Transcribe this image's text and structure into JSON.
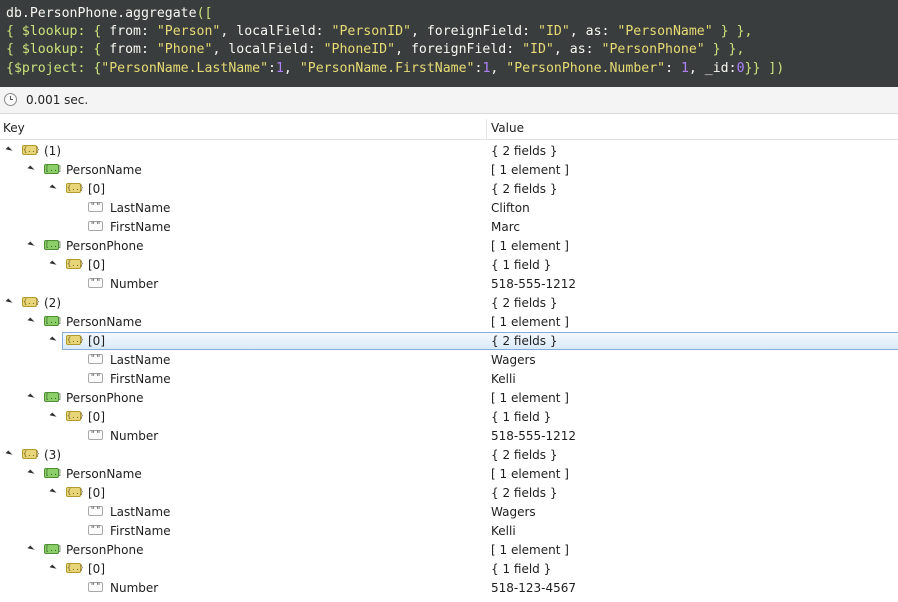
{
  "editor": {
    "lines": [
      [
        [
          "pk",
          "db.PersonPhone.aggregate"
        ],
        [
          "kw",
          "(["
        ]
      ],
      [
        [
          "kw",
          "{ $lookup: { "
        ],
        [
          "pk",
          "from: "
        ],
        [
          "str",
          "\"Person\""
        ],
        [
          "pk",
          ", localField: "
        ],
        [
          "str",
          "\"PersonID\""
        ],
        [
          "pk",
          ", foreignField: "
        ],
        [
          "str",
          "\"ID\""
        ],
        [
          "pk",
          ", as: "
        ],
        [
          "str",
          "\"PersonName\""
        ],
        [
          "kw",
          " } },"
        ]
      ],
      [
        [
          "kw",
          "{ $lookup: { "
        ],
        [
          "pk",
          "from: "
        ],
        [
          "str",
          "\"Phone\""
        ],
        [
          "pk",
          ", localField: "
        ],
        [
          "str",
          "\"PhoneID\""
        ],
        [
          "pk",
          ", foreignField: "
        ],
        [
          "str",
          "\"ID\""
        ],
        [
          "pk",
          ", as: "
        ],
        [
          "str",
          "\"PersonPhone\""
        ],
        [
          "kw",
          " } },"
        ]
      ],
      [
        [
          "kw",
          "{$project: {"
        ],
        [
          "str",
          "\"PersonName.LastName\""
        ],
        [
          "pk",
          ":"
        ],
        [
          "num",
          "1"
        ],
        [
          "pk",
          ", "
        ],
        [
          "str",
          "\"PersonName.FirstName\""
        ],
        [
          "pk",
          ":"
        ],
        [
          "num",
          "1"
        ],
        [
          "pk",
          ", "
        ],
        [
          "str",
          "\"PersonPhone.Number\""
        ],
        [
          "pk",
          ": "
        ],
        [
          "num",
          "1"
        ],
        [
          "pk",
          ", _id:"
        ],
        [
          "num",
          "0"
        ],
        [
          "kw",
          "}} ])"
        ]
      ]
    ]
  },
  "status": {
    "time": "0.001 sec."
  },
  "columns": {
    "key": "Key",
    "value": "Value"
  },
  "rows": [
    {
      "depth": 0,
      "icon": "arr",
      "key": "(1)",
      "value": "{ 2 fields }",
      "expand": true
    },
    {
      "depth": 1,
      "icon": "obj",
      "key": "PersonName",
      "value": "[ 1 element ]",
      "expand": true
    },
    {
      "depth": 2,
      "icon": "arr",
      "key": "[0]",
      "value": "{ 2 fields }",
      "expand": true
    },
    {
      "depth": 3,
      "icon": "str",
      "key": "LastName",
      "value": "Clifton",
      "expand": false
    },
    {
      "depth": 3,
      "icon": "str",
      "key": "FirstName",
      "value": "Marc",
      "expand": false
    },
    {
      "depth": 1,
      "icon": "obj",
      "key": "PersonPhone",
      "value": "[ 1 element ]",
      "expand": true
    },
    {
      "depth": 2,
      "icon": "arr",
      "key": "[0]",
      "value": "{ 1 field }",
      "expand": true
    },
    {
      "depth": 3,
      "icon": "str",
      "key": "Number",
      "value": "518-555-1212",
      "expand": false
    },
    {
      "depth": 0,
      "icon": "arr",
      "key": "(2)",
      "value": "{ 2 fields }",
      "expand": true
    },
    {
      "depth": 1,
      "icon": "obj",
      "key": "PersonName",
      "value": "[ 1 element ]",
      "expand": true
    },
    {
      "depth": 2,
      "icon": "arr",
      "key": "[0]",
      "value": "{ 2 fields }",
      "expand": true,
      "selected": true
    },
    {
      "depth": 3,
      "icon": "str",
      "key": "LastName",
      "value": "Wagers",
      "expand": false
    },
    {
      "depth": 3,
      "icon": "str",
      "key": "FirstName",
      "value": "Kelli",
      "expand": false
    },
    {
      "depth": 1,
      "icon": "obj",
      "key": "PersonPhone",
      "value": "[ 1 element ]",
      "expand": true
    },
    {
      "depth": 2,
      "icon": "arr",
      "key": "[0]",
      "value": "{ 1 field }",
      "expand": true
    },
    {
      "depth": 3,
      "icon": "str",
      "key": "Number",
      "value": "518-555-1212",
      "expand": false
    },
    {
      "depth": 0,
      "icon": "arr",
      "key": "(3)",
      "value": "{ 2 fields }",
      "expand": true
    },
    {
      "depth": 1,
      "icon": "obj",
      "key": "PersonName",
      "value": "[ 1 element ]",
      "expand": true
    },
    {
      "depth": 2,
      "icon": "arr",
      "key": "[0]",
      "value": "{ 2 fields }",
      "expand": true
    },
    {
      "depth": 3,
      "icon": "str",
      "key": "LastName",
      "value": "Wagers",
      "expand": false
    },
    {
      "depth": 3,
      "icon": "str",
      "key": "FirstName",
      "value": "Kelli",
      "expand": false
    },
    {
      "depth": 1,
      "icon": "obj",
      "key": "PersonPhone",
      "value": "[ 1 element ]",
      "expand": true
    },
    {
      "depth": 2,
      "icon": "arr",
      "key": "[0]",
      "value": "{ 1 field }",
      "expand": true
    },
    {
      "depth": 3,
      "icon": "str",
      "key": "Number",
      "value": "518-123-4567",
      "expand": false
    }
  ]
}
